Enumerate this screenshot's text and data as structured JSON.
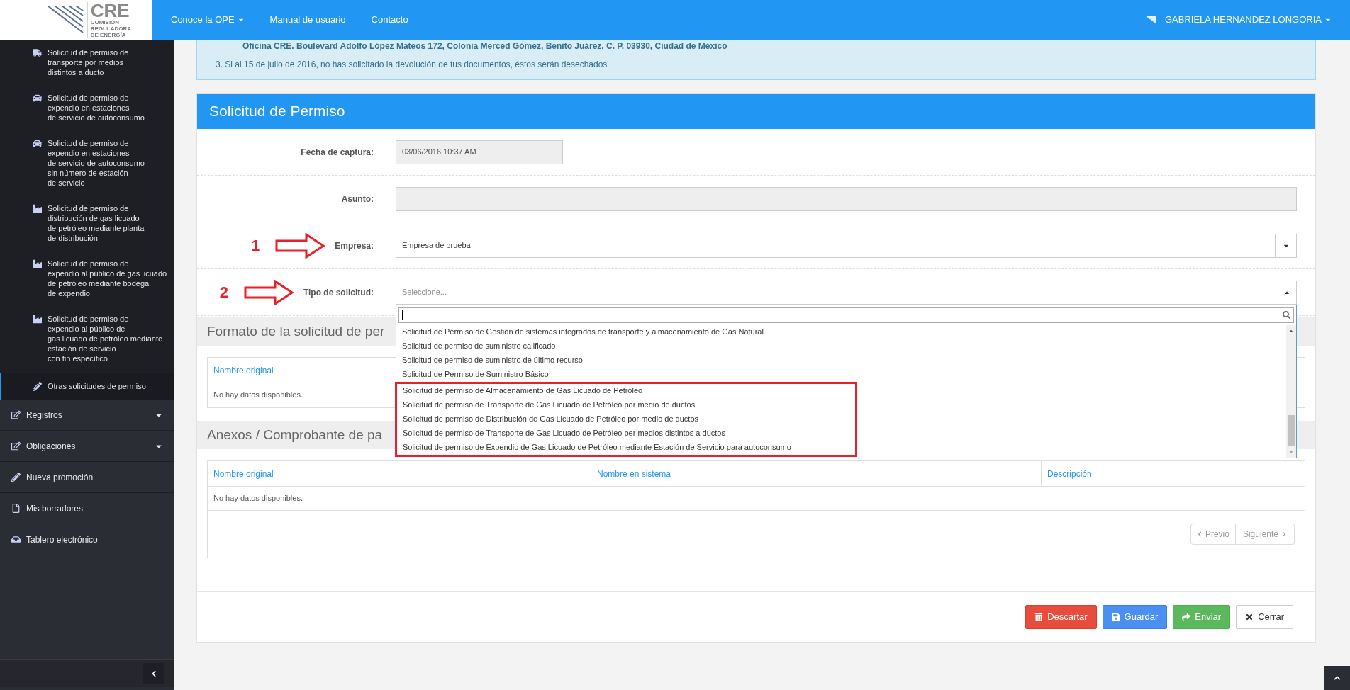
{
  "header": {
    "logo": {
      "title": "CRE",
      "subtitle_lines": [
        "COMISIÓN",
        "REGULADORA",
        "DE ENERGÍA"
      ]
    },
    "nav": [
      {
        "label": "Conoce la OPE",
        "dropdown": true
      },
      {
        "label": "Manual de usuario",
        "dropdown": false
      },
      {
        "label": "Contacto",
        "dropdown": false
      }
    ],
    "user": {
      "name": "GABRIELA HERNANDEZ LONGORIA",
      "dropdown": true
    }
  },
  "sidebar": {
    "items": [
      {
        "kind": "truck",
        "lines": [
          "Solicitud de permiso de",
          "transporte por medios",
          "distintos a ducto"
        ],
        "selected": false
      },
      {
        "kind": "car",
        "lines": [
          "Solicitud de permiso de",
          "expendio en estaciones",
          "de servicio de autoconsumo"
        ],
        "selected": false
      },
      {
        "kind": "car",
        "lines": [
          "Solicitud de permiso de",
          "expendio en estaciones",
          "de servicio de autoconsumo",
          "sin número de estación",
          "de servicio"
        ],
        "selected": false
      },
      {
        "kind": "factory",
        "lines": [
          "Solicitud de permiso de",
          "distribución de gas licuado",
          "de petróleo mediante planta",
          "de distribución"
        ],
        "selected": false
      },
      {
        "kind": "factory",
        "lines": [
          "Solicitud de permiso de",
          "expendio al público de gas licuado",
          "de petróleo mediante bodega",
          "de expendio"
        ],
        "selected": false
      },
      {
        "kind": "factory",
        "lines": [
          "Solicitud de permiso de",
          "expendio al público de",
          "gas licuado de petróleo mediante",
          "estación de servicio",
          "con fin específico"
        ],
        "selected": false
      },
      {
        "kind": "pencil",
        "lines": [
          "Otras solicitudes de permiso"
        ],
        "selected": true
      }
    ],
    "menu": [
      {
        "kind": "edit",
        "label": "Registros",
        "expandable": true
      },
      {
        "kind": "edit",
        "label": "Obligaciones",
        "expandable": true
      },
      {
        "kind": "pencil",
        "label": "Nueva promoción",
        "expandable": false
      },
      {
        "kind": "file",
        "label": "Mis borradores",
        "expandable": false
      },
      {
        "kind": "inbox",
        "label": "Tablero electrónico",
        "expandable": false
      }
    ]
  },
  "alert": {
    "lines": [
      {
        "kind": "address",
        "text": "Oficina CRE. Boulevard Adolfo López Mateos 172, Colonia Merced Gómez, Benito Juárez, C. P. 03930, Ciudad de México"
      },
      {
        "kind": "note",
        "text": "3. Si al 15 de julio de 2016, no has solicitado la devolución de tus documentos, éstos serán desechados"
      }
    ]
  },
  "form": {
    "title": "Solicitud de Permiso",
    "fields": [
      {
        "label": "Fecha de captura:",
        "kind": "short",
        "disabled": true,
        "value": "03/06/2016 10:37 AM"
      },
      {
        "label": "Asunto:",
        "kind": "wide",
        "disabled": true
      },
      {
        "label": "Empresa:",
        "kind": "select",
        "disabled": false,
        "value": "Empresa de prueba",
        "annotation": "1",
        "expanded": false
      },
      {
        "label": "Tipo de solicitud:",
        "kind": "select",
        "disabled": false,
        "placeholder": "Seleccione...",
        "annotation": "2",
        "expanded": true,
        "dropdown": {
          "options": [
            "Solicitud de Permiso de Gestión de sistemas integrados de transporte y almacenamiento de Gas Natural",
            "Solicitud de permiso de suministro calificado",
            "Solicitud de permiso de suministro de último recurso",
            "Solicitud de Permiso de Suministro Básico"
          ],
          "highlighted_options": [
            "Solicitud de permiso de Almacenamiento de Gas Licuado de Petróleo",
            "Solicitud de permiso de Transporte de Gas Licuado de Petróleo por medio de ductos",
            "Solicitud de permiso de Distribución de Gas Licuado de Petróleo por medio de ductos",
            "Solicitud de permiso de Transporte de Gas Licuado de Petróleo per medios distintos a ductos",
            "Solicitud de permiso de Expendio de Gas Licuado de Petróleo mediante Estación de Servicio para autoconsumo"
          ]
        }
      }
    ],
    "sections": [
      {
        "title": "Formato de la solicitud de per",
        "table": {
          "columns": [
            "Nombre original"
          ],
          "empty": "No hay datos disponibles."
        }
      },
      {
        "title": "Anexos / Comprobante de pa",
        "table": {
          "columns": [
            "Nombre original",
            "Nombre en sistema",
            "Descripción"
          ],
          "empty": "No hay datos disponibles."
        },
        "pagination": {
          "previous": "Previo",
          "next": "Siguiente",
          "disabled": true
        }
      }
    ],
    "buttons": [
      {
        "label": "Descartar",
        "kind": "danger"
      },
      {
        "label": "Guardar",
        "kind": "primary"
      },
      {
        "label": "Enviar",
        "kind": "success"
      },
      {
        "label": "Cerrar",
        "kind": "default"
      }
    ]
  }
}
